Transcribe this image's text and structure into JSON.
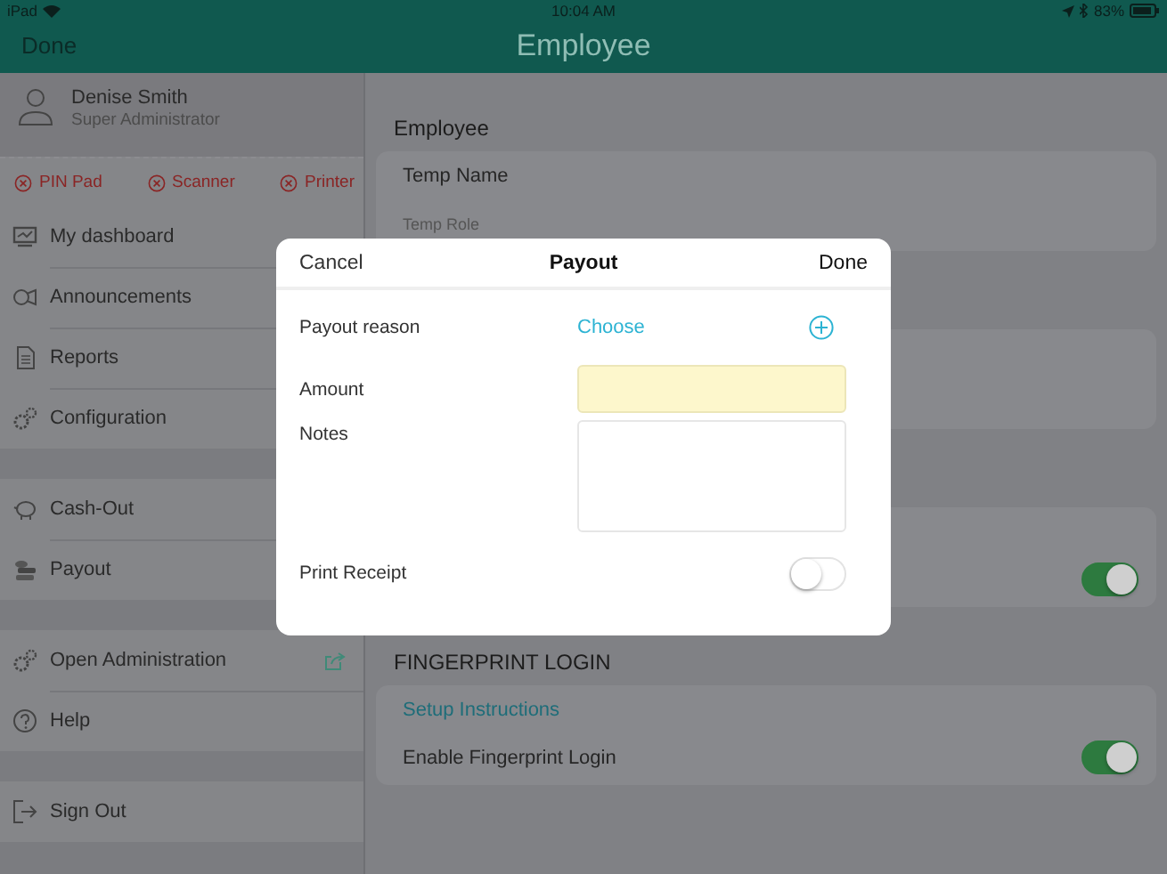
{
  "status_bar": {
    "device": "iPad",
    "time": "10:04 AM",
    "battery": "83%"
  },
  "nav_bar": {
    "left_button": "Done",
    "title": "Employee"
  },
  "sidebar": {
    "profile": {
      "name": "Denise Smith",
      "role": "Super Administrator"
    },
    "devices": [
      {
        "label": "PIN Pad",
        "connected": false
      },
      {
        "label": "Scanner",
        "connected": false
      },
      {
        "label": "Printer",
        "connected": false
      }
    ],
    "groups": [
      {
        "items": [
          {
            "kind": "link",
            "label": "My dashboard"
          },
          {
            "kind": "link",
            "label": "Announcements"
          },
          {
            "kind": "link",
            "label": "Reports"
          },
          {
            "kind": "link",
            "label": "Configuration"
          }
        ]
      },
      {
        "items": [
          {
            "kind": "link",
            "label": "Cash-Out"
          },
          {
            "kind": "link",
            "label": "Payout"
          }
        ]
      },
      {
        "items": [
          {
            "kind": "external",
            "label": "Open Administration"
          },
          {
            "kind": "link",
            "label": "Help"
          }
        ]
      },
      {
        "items": [
          {
            "kind": "link",
            "label": "Sign Out"
          }
        ]
      }
    ]
  },
  "main": {
    "sections": [
      {
        "kind": "card",
        "heading": "Employee",
        "rows": [
          {
            "kind": "title",
            "label": "Temp Name"
          },
          {
            "kind": "caption",
            "label": "Temp Role"
          }
        ]
      },
      {
        "kind": "card"
      },
      {
        "kind": "card",
        "rows": [
          {
            "kind": "switch",
            "on": true
          }
        ]
      },
      {
        "kind": "card",
        "heading": "FINGERPRINT LOGIN",
        "rows": [
          {
            "kind": "link",
            "label": "Setup Instructions"
          },
          {
            "kind": "switch",
            "label": "Enable Fingerprint Login",
            "on": true
          }
        ]
      }
    ]
  },
  "dialog": {
    "cancel": "Cancel",
    "title": "Payout",
    "done": "Done",
    "fields": [
      {
        "kind": "picker",
        "label": "Payout reason",
        "value": "Choose"
      },
      {
        "kind": "input",
        "label": "Amount"
      },
      {
        "kind": "textarea",
        "label": "Notes"
      },
      {
        "kind": "switch",
        "label": "Print Receipt",
        "on": false
      }
    ]
  }
}
